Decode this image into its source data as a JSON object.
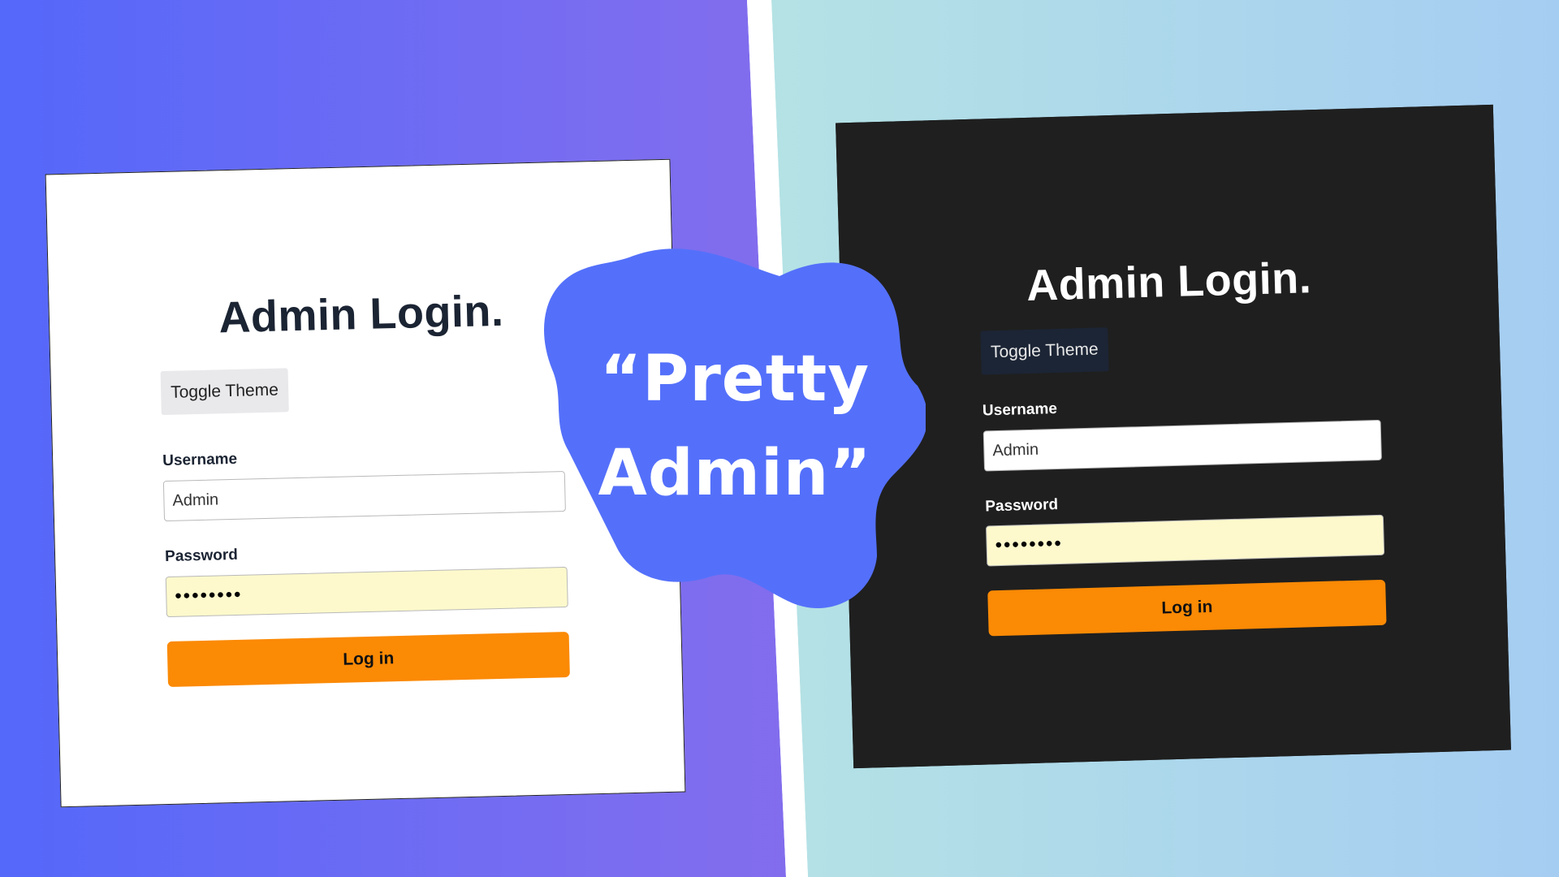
{
  "colors": {
    "accent_orange": "#fb8a05",
    "blob_blue": "#5470fa",
    "dark_card": "#1f1f1f",
    "password_fill": "#fdf9cc"
  },
  "light_card": {
    "title": "Admin Login.",
    "toggle_label": "Toggle Theme",
    "username_label": "Username",
    "username_value": "Admin",
    "password_label": "Password",
    "password_value": "••••••••",
    "login_label": "Log in"
  },
  "dark_card": {
    "title": "Admin Login.",
    "toggle_label": "Toggle Theme",
    "username_label": "Username",
    "username_value": "Admin",
    "password_label": "Password",
    "password_value": "••••••••",
    "login_label": "Log in"
  },
  "blob": {
    "line1": "“Pretty",
    "line2": "Admin”"
  }
}
